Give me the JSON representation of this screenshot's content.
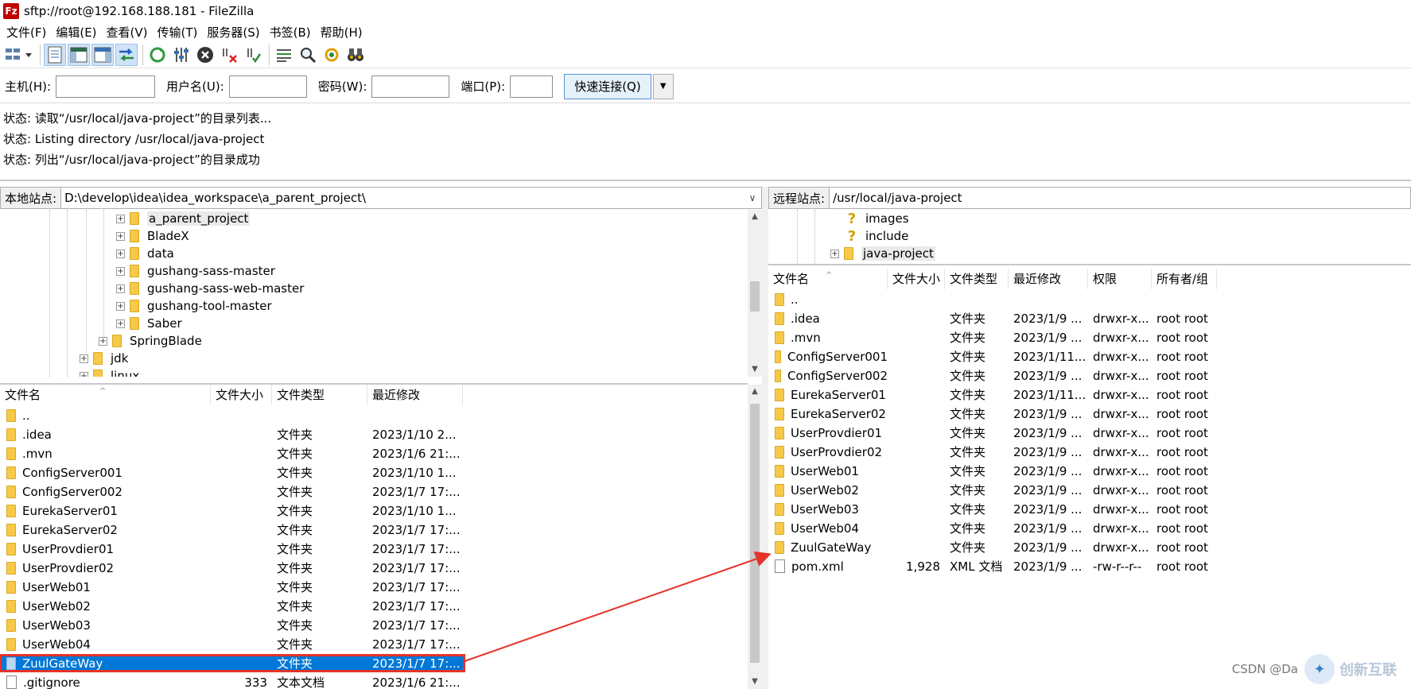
{
  "window": {
    "title": "sftp://root@192.168.188.181 - FileZilla",
    "app_icon": "Fz"
  },
  "menu": [
    "文件(F)",
    "编辑(E)",
    "查看(V)",
    "传输(T)",
    "服务器(S)",
    "书签(B)",
    "帮助(H)"
  ],
  "quickconnect": {
    "host_label": "主机(H):",
    "host_value": "",
    "user_label": "用户名(U):",
    "user_value": "",
    "pass_label": "密码(W):",
    "pass_value": "",
    "port_label": "端口(P):",
    "port_value": "",
    "connect_label": "快速连接(Q)"
  },
  "log": [
    "状态:  读取“/usr/local/java-project”的目录列表...",
    "状态:  Listing directory /usr/local/java-project",
    "状态:  列出“/usr/local/java-project”的目录成功"
  ],
  "local": {
    "site_label": "本地站点:",
    "path": "D:\\develop\\idea\\idea_workspace\\a_parent_project\\",
    "tree": [
      {
        "name": "a_parent_project",
        "level": 3,
        "highlight": true
      },
      {
        "name": "BladeX",
        "level": 3
      },
      {
        "name": "data",
        "level": 3
      },
      {
        "name": "gushang-sass-master",
        "level": 3
      },
      {
        "name": "gushang-sass-web-master",
        "level": 3
      },
      {
        "name": "gushang-tool-master",
        "level": 3
      },
      {
        "name": "Saber",
        "level": 3
      },
      {
        "name": "SpringBlade",
        "level": 2
      },
      {
        "name": "jdk",
        "level": 1
      },
      {
        "name": "linux",
        "level": 1
      }
    ],
    "columns": [
      "文件名",
      "文件大小",
      "文件类型",
      "最近修改"
    ],
    "files": [
      {
        "name": "..",
        "size": "",
        "type": "",
        "modified": "",
        "kind": "folder"
      },
      {
        "name": ".idea",
        "size": "",
        "type": "文件夹",
        "modified": "2023/1/10 2...",
        "kind": "folder"
      },
      {
        "name": ".mvn",
        "size": "",
        "type": "文件夹",
        "modified": "2023/1/6 21:...",
        "kind": "folder"
      },
      {
        "name": "ConfigServer001",
        "size": "",
        "type": "文件夹",
        "modified": "2023/1/10 1...",
        "kind": "folder"
      },
      {
        "name": "ConfigServer002",
        "size": "",
        "type": "文件夹",
        "modified": "2023/1/7 17:...",
        "kind": "folder"
      },
      {
        "name": "EurekaServer01",
        "size": "",
        "type": "文件夹",
        "modified": "2023/1/10 1...",
        "kind": "folder"
      },
      {
        "name": "EurekaServer02",
        "size": "",
        "type": "文件夹",
        "modified": "2023/1/7 17:...",
        "kind": "folder"
      },
      {
        "name": "UserProvdier01",
        "size": "",
        "type": "文件夹",
        "modified": "2023/1/7 17:...",
        "kind": "folder"
      },
      {
        "name": "UserProvdier02",
        "size": "",
        "type": "文件夹",
        "modified": "2023/1/7 17:...",
        "kind": "folder"
      },
      {
        "name": "UserWeb01",
        "size": "",
        "type": "文件夹",
        "modified": "2023/1/7 17:...",
        "kind": "folder"
      },
      {
        "name": "UserWeb02",
        "size": "",
        "type": "文件夹",
        "modified": "2023/1/7 17:...",
        "kind": "folder"
      },
      {
        "name": "UserWeb03",
        "size": "",
        "type": "文件夹",
        "modified": "2023/1/7 17:...",
        "kind": "folder"
      },
      {
        "name": "UserWeb04",
        "size": "",
        "type": "文件夹",
        "modified": "2023/1/7 17:...",
        "kind": "folder"
      },
      {
        "name": "ZuulGateWay",
        "size": "",
        "type": "文件夹",
        "modified": "2023/1/7 17:...",
        "kind": "folder",
        "selected": true
      },
      {
        "name": ".gitignore",
        "size": "333",
        "type": "文本文档",
        "modified": "2023/1/6 21:...",
        "kind": "file"
      }
    ]
  },
  "remote": {
    "site_label": "远程站点:",
    "path": "/usr/local/java-project",
    "tree": [
      {
        "name": "images",
        "icon": "unknown"
      },
      {
        "name": "include",
        "icon": "unknown"
      },
      {
        "name": "java-project",
        "icon": "folder",
        "highlight": true
      }
    ],
    "columns": [
      "文件名",
      "文件大小",
      "文件类型",
      "最近修改",
      "权限",
      "所有者/组"
    ],
    "files": [
      {
        "name": "..",
        "size": "",
        "type": "",
        "modified": "",
        "perm": "",
        "owner": "",
        "kind": "folder"
      },
      {
        "name": ".idea",
        "size": "",
        "type": "文件夹",
        "modified": "2023/1/9 ...",
        "perm": "drwxr-x...",
        "owner": "root root",
        "kind": "folder"
      },
      {
        "name": ".mvn",
        "size": "",
        "type": "文件夹",
        "modified": "2023/1/9 ...",
        "perm": "drwxr-x...",
        "owner": "root root",
        "kind": "folder"
      },
      {
        "name": "ConfigServer001",
        "size": "",
        "type": "文件夹",
        "modified": "2023/1/11...",
        "perm": "drwxr-x...",
        "owner": "root root",
        "kind": "folder"
      },
      {
        "name": "ConfigServer002",
        "size": "",
        "type": "文件夹",
        "modified": "2023/1/9 ...",
        "perm": "drwxr-x...",
        "owner": "root root",
        "kind": "folder"
      },
      {
        "name": "EurekaServer01",
        "size": "",
        "type": "文件夹",
        "modified": "2023/1/11...",
        "perm": "drwxr-x...",
        "owner": "root root",
        "kind": "folder"
      },
      {
        "name": "EurekaServer02",
        "size": "",
        "type": "文件夹",
        "modified": "2023/1/9 ...",
        "perm": "drwxr-x...",
        "owner": "root root",
        "kind": "folder"
      },
      {
        "name": "UserProvdier01",
        "size": "",
        "type": "文件夹",
        "modified": "2023/1/9 ...",
        "perm": "drwxr-x...",
        "owner": "root root",
        "kind": "folder"
      },
      {
        "name": "UserProvdier02",
        "size": "",
        "type": "文件夹",
        "modified": "2023/1/9 ...",
        "perm": "drwxr-x...",
        "owner": "root root",
        "kind": "folder"
      },
      {
        "name": "UserWeb01",
        "size": "",
        "type": "文件夹",
        "modified": "2023/1/9 ...",
        "perm": "drwxr-x...",
        "owner": "root root",
        "kind": "folder"
      },
      {
        "name": "UserWeb02",
        "size": "",
        "type": "文件夹",
        "modified": "2023/1/9 ...",
        "perm": "drwxr-x...",
        "owner": "root root",
        "kind": "folder"
      },
      {
        "name": "UserWeb03",
        "size": "",
        "type": "文件夹",
        "modified": "2023/1/9 ...",
        "perm": "drwxr-x...",
        "owner": "root root",
        "kind": "folder"
      },
      {
        "name": "UserWeb04",
        "size": "",
        "type": "文件夹",
        "modified": "2023/1/9 ...",
        "perm": "drwxr-x...",
        "owner": "root root",
        "kind": "folder"
      },
      {
        "name": "ZuulGateWay",
        "size": "",
        "type": "文件夹",
        "modified": "2023/1/9 ...",
        "perm": "drwxr-x...",
        "owner": "root root",
        "kind": "folder"
      },
      {
        "name": "pom.xml",
        "size": "1,928",
        "type": "XML 文档",
        "modified": "2023/1/9 ...",
        "perm": "-rw-r--r--",
        "owner": "root root",
        "kind": "file"
      }
    ]
  },
  "watermark": {
    "text": "CSDN @Da",
    "brand": "创新互联"
  },
  "colors": {
    "selection": "#0078d7",
    "annotation": "#e5332a",
    "folder": "#f7c948"
  }
}
